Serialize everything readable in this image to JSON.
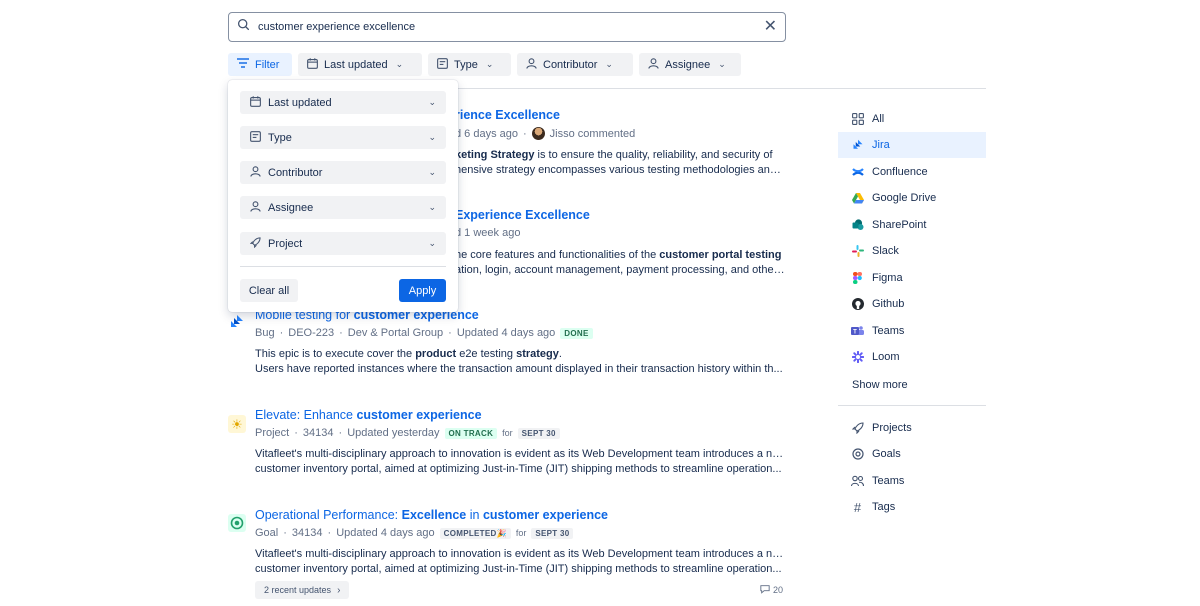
{
  "search": {
    "value": "customer experience excellence"
  },
  "filters": {
    "filter_label": "Filter",
    "last_updated": "Last updated",
    "type": "Type",
    "contributor": "Contributor",
    "assignee": "Assignee"
  },
  "dropdown": {
    "items": [
      "Last updated",
      "Type",
      "Contributor",
      "Assignee",
      "Project"
    ],
    "clear_all": "Clear all",
    "apply": "Apply"
  },
  "results": [
    {
      "title_plain": "",
      "title_bold": "rience Excellence",
      "meta_pre": "d 6 days ago",
      "meta_after": "Jisso commented",
      "desc1_bold": "keting Strategy",
      "desc1_plain": " is to ensure the quality, reliability, and security of",
      "desc2": "hensive strategy encompasses various testing methodologies and..."
    },
    {
      "title_bold": "Experience Excellence",
      "meta_pre": "d 1 week ago",
      "desc1_plain": "he core features and functionalities of the ",
      "desc1_bold": "customer portal testing",
      "desc2": "ation, login, account management, payment processing, and other..."
    },
    {
      "title_plain": "Mobile testing for ",
      "title_bold": "customer experience",
      "meta_type": "Bug",
      "meta_key": "DEO-223",
      "meta_group": "Dev & Portal Group",
      "meta_updated": "Updated 4 days ago",
      "lozenge": "DONE",
      "desc1_a": "This epic is to execute cover the ",
      "desc1_b": "product",
      "desc1_c": " e2e testing ",
      "desc1_d": "strategy",
      "desc1_e": ".",
      "desc2": "Users have reported instances where the transaction amount displayed in their transaction history within th..."
    },
    {
      "title_plain": "Elevate: Enhance ",
      "title_bold": "customer experience",
      "meta_type": "Project",
      "meta_key": "34134",
      "meta_updated": "Updated yesterday",
      "lozenge": "ON TRACK",
      "for": "for",
      "date": "SEPT 30",
      "desc1": "Vitafleet's multi-disciplinary approach to innovation is evident as its Web Development team introduces a new",
      "desc2": "customer inventory portal, aimed at optimizing Just-in-Time (JIT) shipping methods to streamline operation..."
    },
    {
      "title_plain": "Operational Performance: ",
      "title_bold1": "Excellence",
      "title_mid": " in ",
      "title_bold2": "customer experience",
      "meta_type": "Goal",
      "meta_key": "34134",
      "meta_updated": "Updated 4 days ago",
      "lozenge": "COMPLETED🎉",
      "for": "for",
      "date": "SEPT 30",
      "desc1": "Vitafleet's multi-disciplinary approach to innovation is evident as its Web Development team introduces a new",
      "desc2": "customer inventory portal, aimed at optimizing Just-in-Time (JIT) shipping methods to streamline operation...",
      "recent_updates": "2 recent updates",
      "comments": "20"
    }
  ],
  "sidebar": {
    "products": [
      "All",
      "Jira",
      "Confluence",
      "Google Drive",
      "SharePoint",
      "Slack",
      "Figma",
      "Github",
      "Teams",
      "Loom"
    ],
    "show_more": "Show more",
    "entities": [
      "Projects",
      "Goals",
      "Teams",
      "Tags"
    ]
  },
  "colors": {
    "accent": "#0c66e4",
    "selected_bg": "#e9f2ff"
  }
}
